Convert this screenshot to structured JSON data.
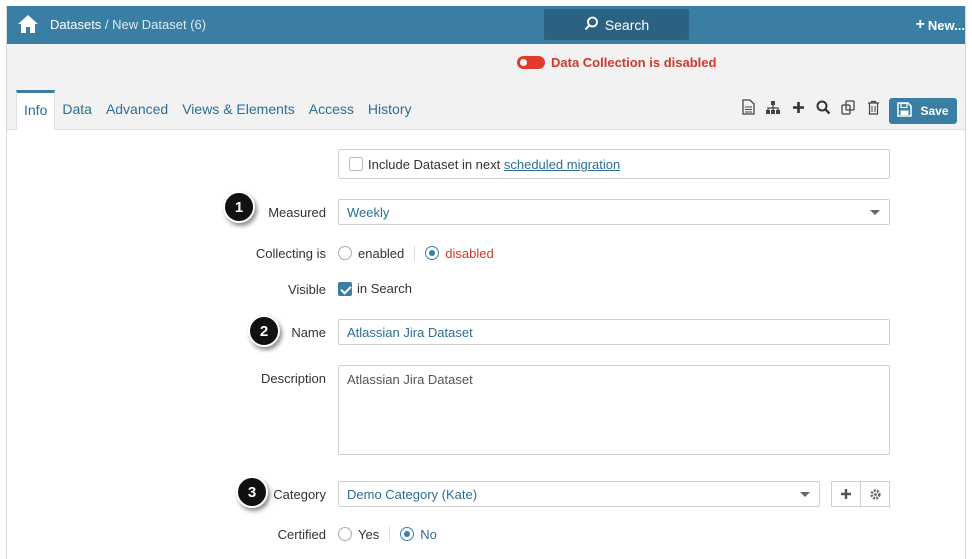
{
  "topbar": {
    "breadcrumb_root": "Datasets",
    "breadcrumb_sep": " / ",
    "breadcrumb_current": "New Dataset (6)",
    "search_label": "Search",
    "new_label": "New..."
  },
  "status": {
    "data_collection": "Data Collection is disabled"
  },
  "tabs": [
    {
      "label": "Info",
      "active": true
    },
    {
      "label": "Data"
    },
    {
      "label": "Advanced"
    },
    {
      "label": "Views & Elements"
    },
    {
      "label": "Access"
    },
    {
      "label": "History"
    }
  ],
  "toolbar": {
    "icons": [
      "document-icon",
      "hierarchy-icon",
      "plus-icon",
      "search-icon",
      "copy-icon",
      "trash-icon"
    ],
    "save_label": "Save"
  },
  "form": {
    "migration": {
      "text": "Include Dataset in next ",
      "link": "scheduled migration",
      "checked": false
    },
    "measured": {
      "label": "Measured",
      "value": "Weekly"
    },
    "collecting": {
      "label": "Collecting is",
      "options": [
        "enabled",
        "disabled"
      ],
      "selected": "disabled"
    },
    "visible": {
      "label": "Visible",
      "checkbox_label": "in Search",
      "checked": true
    },
    "name": {
      "label": "Name",
      "value": "Atlassian Jira Dataset"
    },
    "description": {
      "label": "Description",
      "value": "Atlassian Jira Dataset"
    },
    "category": {
      "label": "Category",
      "value": "Demo Category (Kate)"
    },
    "certified": {
      "label": "Certified",
      "options": [
        "Yes",
        "No"
      ],
      "selected": "No"
    }
  },
  "markers": [
    "1",
    "2",
    "3"
  ],
  "colors": {
    "brand": "#3a7fa3",
    "search_button": "#2b6282",
    "disabled_red": "#d0392b",
    "link": "#2c6f95"
  }
}
